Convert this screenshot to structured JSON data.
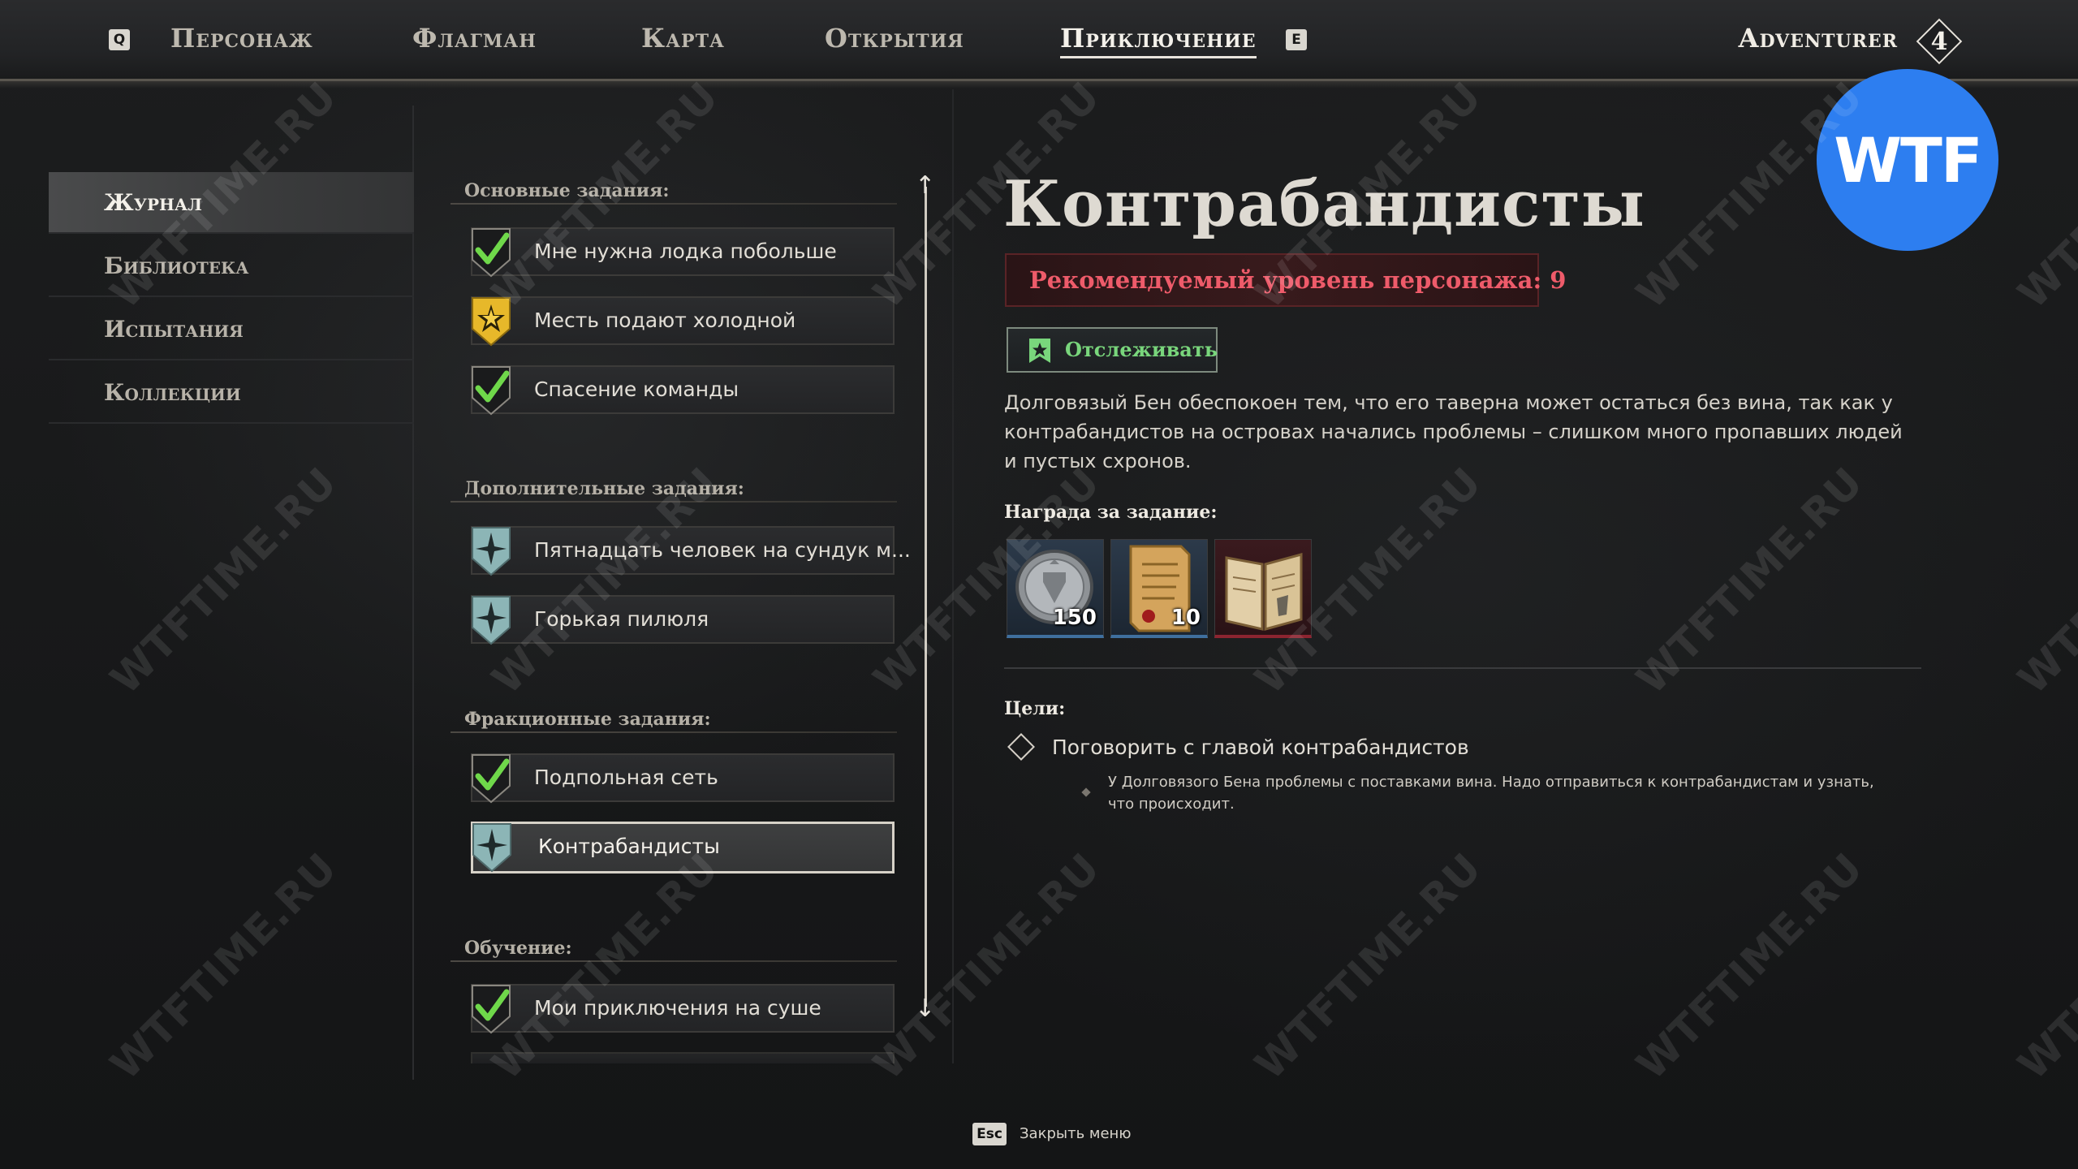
{
  "nav": {
    "key_left": "Q",
    "key_right": "E",
    "tabs": [
      {
        "label": "Персонаж"
      },
      {
        "label": "Флагман"
      },
      {
        "label": "Карта"
      },
      {
        "label": "Открытия"
      },
      {
        "label": "Приключение",
        "active": true
      }
    ],
    "player_name": "Adventurer",
    "player_level": "4"
  },
  "badge": {
    "text": "WTF"
  },
  "sidebar": {
    "items": [
      {
        "label": "Журнал",
        "active": true
      },
      {
        "label": "Библиотека"
      },
      {
        "label": "Испытания"
      },
      {
        "label": "Коллекции"
      }
    ]
  },
  "quests": {
    "sections": [
      {
        "title": "Основные задания:",
        "items": [
          {
            "label": "Мне нужна лодка побольше",
            "icon": "check-icon"
          },
          {
            "label": "Месть подают холодной",
            "icon": "gold-star-icon"
          },
          {
            "label": "Спасение команды",
            "icon": "check-icon"
          }
        ]
      },
      {
        "title": "Дополнительные задания:",
        "items": [
          {
            "label": "Пятнадцать человек на сундук м...",
            "icon": "compass-star-icon"
          },
          {
            "label": "Горькая пилюля",
            "icon": "compass-star-icon"
          }
        ]
      },
      {
        "title": "Фракционные задания:",
        "items": [
          {
            "label": "Подпольная сеть",
            "icon": "check-icon"
          },
          {
            "label": "Контрабандисты",
            "icon": "compass-star-icon",
            "selected": true
          }
        ]
      },
      {
        "title": "Обучение:",
        "items": [
          {
            "label": "Мои приключения на суше",
            "icon": "check-icon"
          }
        ]
      }
    ]
  },
  "detail": {
    "title": "Контрабандисты",
    "recommended_level": "Рекомендуемый уровень персонажа: 9",
    "track_label": "Отслеживать",
    "description": "Долговязый Бен обеспокоен тем, что его таверна может остаться без вина, так как у контрабандистов на островах начались проблемы – слишком много пропавших людей и пустых схронов.",
    "reward_title": "Награда за задание:",
    "rewards": [
      {
        "name": "silver-coin-icon",
        "count": "150"
      },
      {
        "name": "parchment-scroll-icon",
        "count": "10"
      },
      {
        "name": "open-book-icon",
        "count": ""
      }
    ],
    "goals_title": "Цели:",
    "goal": "Поговорить с главой контрабандистов",
    "goal_detail": "У Долговязого Бена проблемы с поставками вина. Надо отправиться к контрабандистам и узнать, что происходит."
  },
  "footer": {
    "esc_key": "Esc",
    "close_label": "Закрыть меню"
  },
  "watermark": "WTFTIME.RU",
  "colors": {
    "accent_red": "#ee5b6a",
    "track_green": "#79d67c",
    "badge_blue": "#2d7ef0"
  }
}
